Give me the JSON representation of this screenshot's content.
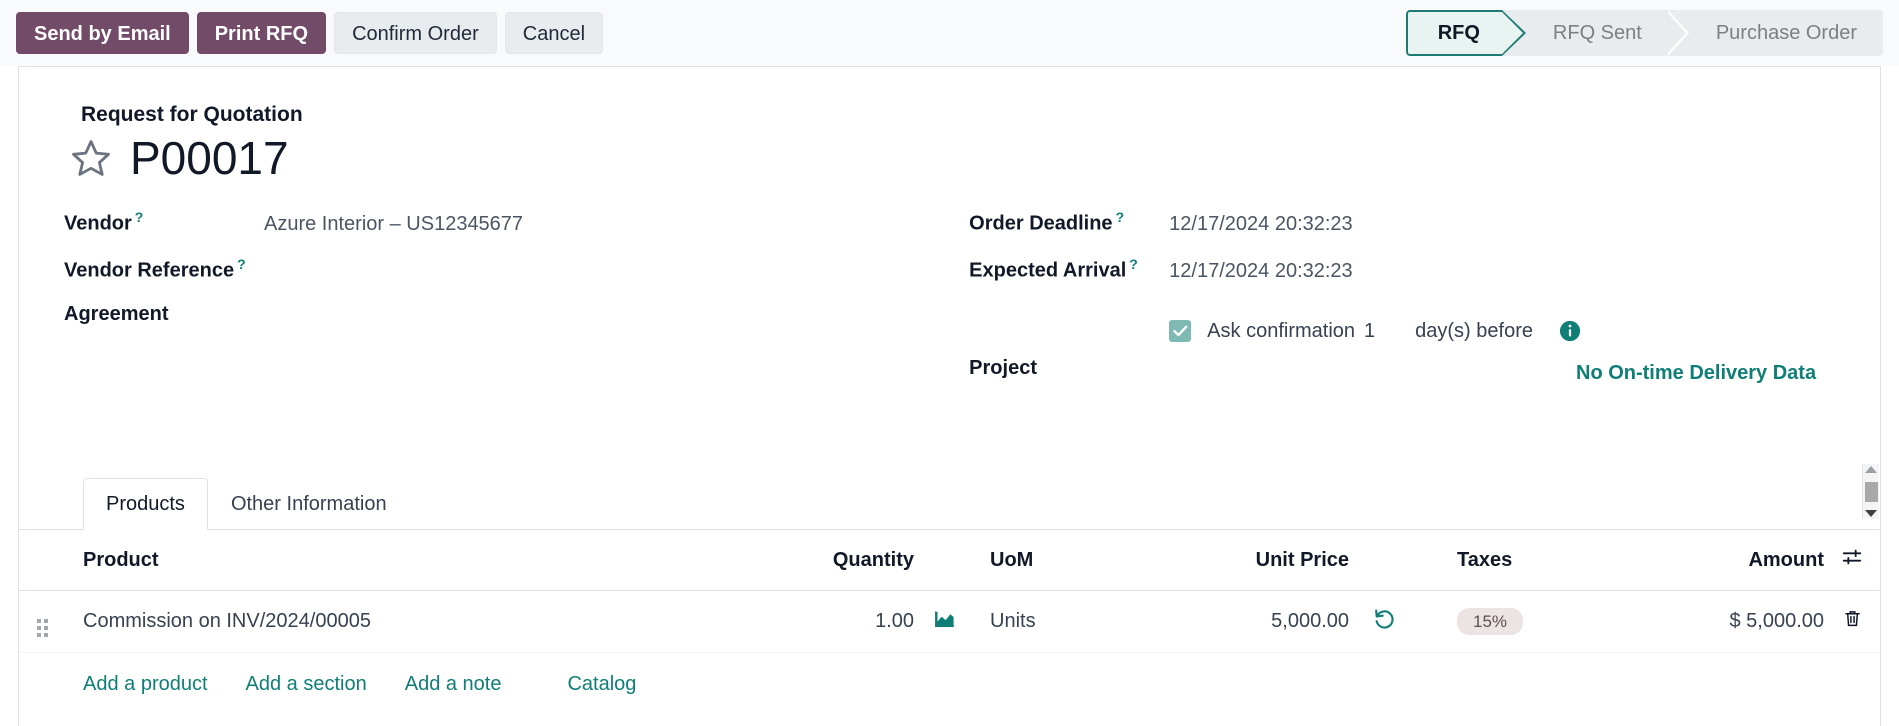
{
  "toolbar": {
    "buttons": [
      {
        "label": "Send by Email",
        "style": "primary"
      },
      {
        "label": "Print RFQ",
        "style": "primary"
      },
      {
        "label": "Confirm Order",
        "style": "secondary"
      },
      {
        "label": "Cancel",
        "style": "secondary"
      }
    ]
  },
  "statusbar": {
    "steps": [
      {
        "label": "RFQ",
        "active": true
      },
      {
        "label": "RFQ Sent",
        "active": false
      },
      {
        "label": "Purchase Order",
        "active": false
      }
    ],
    "active_color": "#1d7b74",
    "active_bg": "#e8f3f2"
  },
  "header": {
    "subtitle": "Request for Quotation",
    "title": "P00017",
    "favorite_icon": "star-icon",
    "favorited": false
  },
  "form": {
    "left": [
      {
        "label": "Vendor",
        "help": true,
        "value": "Azure Interior – US12345677"
      },
      {
        "label": "Vendor Reference",
        "help": true,
        "value": ""
      },
      {
        "label": "Agreement",
        "help": false,
        "value": ""
      }
    ],
    "right": [
      {
        "label": "Order Deadline",
        "help": true,
        "value": "12/17/2024 20:32:23"
      },
      {
        "label": "Expected Arrival",
        "help": true,
        "value": "12/17/2024 20:32:23"
      },
      {
        "label": "Project",
        "help": false,
        "value": ""
      }
    ],
    "ontime_link": "No On-time Delivery Data",
    "confirmation": {
      "checked": true,
      "label": "Ask confirmation",
      "days": "1",
      "unit": "day(s) before",
      "info_icon": "info-icon"
    }
  },
  "notebook": {
    "tabs": [
      {
        "label": "Products",
        "active": true
      },
      {
        "label": "Other Information",
        "active": false
      }
    ]
  },
  "lines": {
    "columns": [
      "Product",
      "Quantity",
      "UoM",
      "Unit Price",
      "Taxes",
      "Amount"
    ],
    "optional_columns_icon": "sliders-icon",
    "rows": [
      {
        "handle_icon": "drag-handle-icon",
        "product": "Commission on INV/2024/00005",
        "quantity": "1.00",
        "quantity_icon": "forecast-chart-icon",
        "uom": "Units",
        "unit_price": "5,000.00",
        "price_icon": "price-history-icon",
        "taxes": "15%",
        "amount": "$ 5,000.00",
        "delete_icon": "trash-icon"
      }
    ],
    "add_links": [
      "Add a product",
      "Add a section",
      "Add a note"
    ],
    "catalog_link": "Catalog"
  },
  "scrollbar": {
    "up_icon": "caret-up-icon",
    "down_icon": "caret-down-icon"
  },
  "colors": {
    "primary": "#714b67",
    "accent_teal": "#0f7e77",
    "tax_badge_bg": "#ece4e4"
  }
}
